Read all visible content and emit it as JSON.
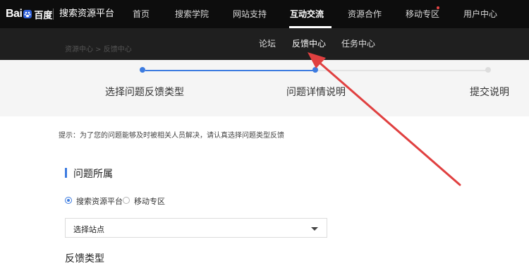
{
  "brand": {
    "logo_text": "Bai",
    "logo_text_2": "百度",
    "title": "搜索资源平台"
  },
  "nav": {
    "items": [
      "首页",
      "搜索学院",
      "网站支持",
      "互动交流",
      "资源合作",
      "移动专区",
      "用户中心"
    ],
    "active": "互动交流"
  },
  "subnav": {
    "breadcrumb": "资源中心 > 反馈中心",
    "items": [
      "论坛",
      "反馈中心",
      "任务中心"
    ],
    "active": "反馈中心"
  },
  "steps": {
    "labels": [
      "选择问题反馈类型",
      "问题详情说明",
      "提交说明"
    ],
    "current": 2
  },
  "form": {
    "hint": "提示：为了您的问题能够及时被相关人员解决，请认真选择问题类型反馈",
    "section_title": "问题所属",
    "radio_options": [
      "搜索资源平台",
      "移动专区"
    ],
    "radio_selected": "搜索资源平台",
    "select_value": "选择站点",
    "feedback_type_title": "反馈类型"
  },
  "colors": {
    "accent": "#3c7be0",
    "annotation_arrow": "#e04040",
    "nav_bg": "#0d0d0d",
    "subnav_bg": "#1f1f1f",
    "notify_dot": "#e64545"
  }
}
